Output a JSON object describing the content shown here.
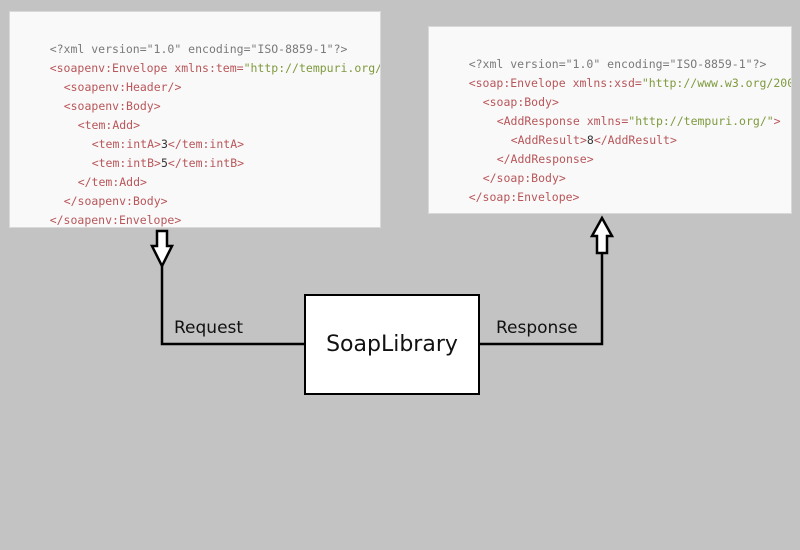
{
  "request_xml": {
    "decl_open": "<?xml version=\"1.0\" encoding=\"ISO-8859-1\"?>",
    "envelope_open_tag": "<soapenv:Envelope",
    "envelope_attr_name": " xmlns:tem=",
    "envelope_attr_value": "\"http://tempuri.org/",
    "header": "<soapenv:Header/>",
    "body_open": "<soapenv:Body>",
    "add_open": "<tem:Add>",
    "intA_open": "<tem:intA>",
    "intA_value": "3",
    "intA_close": "</tem:intA>",
    "intB_open": "<tem:intB>",
    "intB_value": "5",
    "intB_close": "</tem:intB>",
    "add_close": "</tem:Add>",
    "body_close": "</soapenv:Body>",
    "envelope_close": "</soapenv:Envelope>"
  },
  "response_xml": {
    "decl_open": "<?xml version=\"1.0\" encoding=\"ISO-8859-1\"?>",
    "envelope_open_tag": "<soap:Envelope",
    "envelope_attr_name": " xmlns:xsd=",
    "envelope_attr_value": "\"http://www.w3.org/200",
    "body_open": "<soap:Body>",
    "addresponse_open_tag": "<AddResponse",
    "addresponse_attr_name": " xmlns=",
    "addresponse_attr_value": "\"http://tempuri.org/\"",
    "addresponse_open_end": ">",
    "addresult_open": "<AddResult>",
    "addresult_value": "8",
    "addresult_close": "</AddResult>",
    "addresponse_close": "</AddResponse>",
    "body_close": "</soap:Body>",
    "envelope_close": "</soap:Envelope>"
  },
  "diagram": {
    "library_label": "SoapLibrary",
    "request_label": "Request",
    "response_label": "Response"
  },
  "colors": {
    "background": "#c3c3c3",
    "panel": "#f9f9f9",
    "tag": "#b8565a",
    "attr_value": "#7f9a3f",
    "declaration": "#7a7a7a"
  }
}
